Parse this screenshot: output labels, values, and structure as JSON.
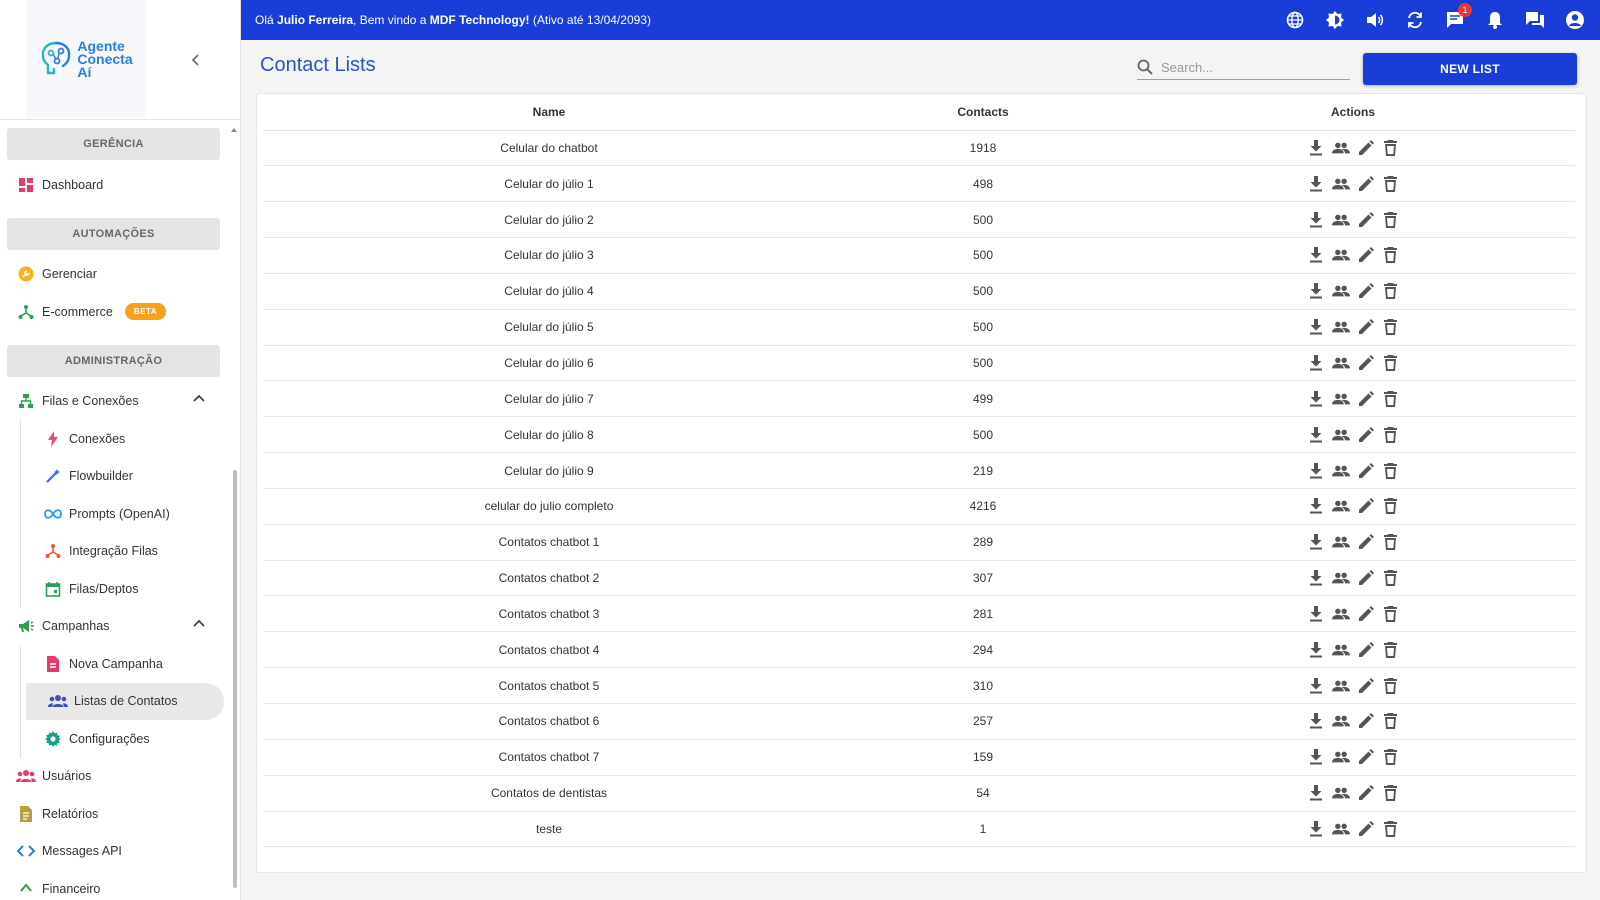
{
  "sidebar": {
    "logo": {
      "line1": "Agente",
      "line2": "Conecta",
      "line3": "Aí"
    },
    "sections": {
      "gerencia": "GERÊNCIA",
      "automacoes": "AUTOMAÇÕES",
      "administracao": "ADMINISTRAÇÃO"
    },
    "items": {
      "dashboard": "Dashboard",
      "gerenciar": "Gerenciar",
      "ecommerce": "E-commerce",
      "beta": "BETA",
      "filas_conexoes": "Filas e Conexões",
      "conexoes": "Conexões",
      "flowbuilder": "Flowbuilder",
      "prompts": "Prompts (OpenAI)",
      "integracao": "Integração Filas",
      "filas_deptos": "Filas/Deptos",
      "campanhas": "Campanhas",
      "nova_campanha": "Nova Campanha",
      "listas_contatos": "Listas de Contatos",
      "configuracoes": "Configurações",
      "usuarios": "Usuários",
      "relatorios": "Relatórios",
      "messages_api": "Messages API",
      "financeiro": "Financeiro"
    }
  },
  "topbar": {
    "hello": "Olá ",
    "user": "Julio Ferreira",
    "welcome": ", Bem vindo a ",
    "company": "MDF Technology!",
    "active_until": " (Ativo até 13/04/2093)",
    "chat_badge": "1"
  },
  "main": {
    "title": "Contact Lists",
    "search_placeholder": "Search...",
    "new_button": "NEW LIST",
    "columns": {
      "name": "Name",
      "contacts": "Contacts",
      "actions": "Actions"
    },
    "rows": [
      {
        "name": "Celular do chatbot",
        "contacts": "1918"
      },
      {
        "name": "Celular do júlio 1",
        "contacts": "498"
      },
      {
        "name": "Celular do júlio 2",
        "contacts": "500"
      },
      {
        "name": "Celular do júlio 3",
        "contacts": "500"
      },
      {
        "name": "Celular do júlio 4",
        "contacts": "500"
      },
      {
        "name": "Celular do júlio 5",
        "contacts": "500"
      },
      {
        "name": "Celular do júlio 6",
        "contacts": "500"
      },
      {
        "name": "Celular do júlio 7",
        "contacts": "499"
      },
      {
        "name": "Celular do júlio 8",
        "contacts": "500"
      },
      {
        "name": "Celular do júlio 9",
        "contacts": "219"
      },
      {
        "name": "celular do julio completo",
        "contacts": "4216"
      },
      {
        "name": "Contatos chatbot 1",
        "contacts": "289"
      },
      {
        "name": "Contatos chatbot 2",
        "contacts": "307"
      },
      {
        "name": "Contatos chatbot 3",
        "contacts": "281"
      },
      {
        "name": "Contatos chatbot 4",
        "contacts": "294"
      },
      {
        "name": "Contatos chatbot 5",
        "contacts": "310"
      },
      {
        "name": "Contatos chatbot 6",
        "contacts": "257"
      },
      {
        "name": "Contatos chatbot 7",
        "contacts": "159"
      },
      {
        "name": "Contatos de dentistas",
        "contacts": "54"
      },
      {
        "name": "teste",
        "contacts": "1"
      }
    ]
  },
  "icons": {
    "row_actions": [
      "download-icon",
      "people-icon",
      "edit-icon",
      "delete-icon"
    ],
    "topbar": [
      "globe-icon",
      "brightness-icon",
      "volume-icon",
      "refresh-icon",
      "chat-icon",
      "bell-icon",
      "forum-icon",
      "account-icon"
    ]
  },
  "colors": {
    "primary": "#1a3dd8",
    "title": "#2c54c4",
    "beta": "#f7a01c",
    "badge": "#e53935"
  }
}
